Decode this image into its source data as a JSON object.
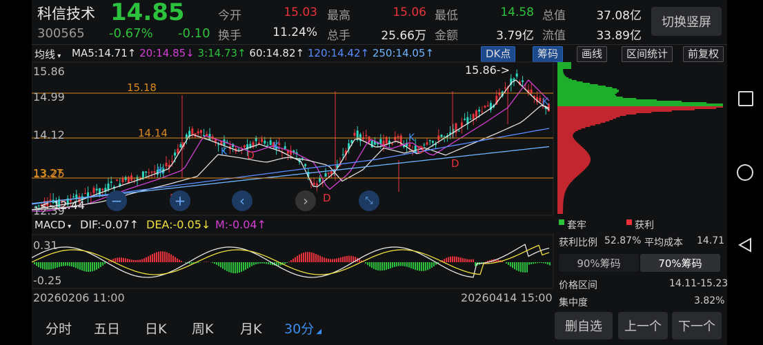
{
  "header": {
    "name": "科信技术",
    "price": "14.85",
    "code": "300565",
    "change_pct": "-0.67%",
    "change": "-0.10",
    "quotes": [
      {
        "label": "今开",
        "value": "15.03",
        "color": "#e8323c"
      },
      {
        "label": "最高",
        "value": "15.06",
        "color": "#e8323c"
      },
      {
        "label": "最低",
        "value": "14.58",
        "color": "#2cc23e"
      },
      {
        "label": "总值",
        "value": "37.08亿",
        "color": "#e8e8e8"
      },
      {
        "label": "换手",
        "value": "11.24%",
        "color": "#e8e8e8"
      },
      {
        "label": "总手",
        "value": "25.66万",
        "color": "#e8e8e8"
      },
      {
        "label": "金额",
        "value": "3.79亿",
        "color": "#e8e8e8"
      },
      {
        "label": "流值",
        "value": "33.89亿",
        "color": "#e8e8e8"
      }
    ],
    "switch_label": "切换竖屏"
  },
  "ma_bar": {
    "selector": "均线",
    "items": [
      {
        "text": "MA5:14.71↑",
        "color": "#e8e8e8"
      },
      {
        "text": "20:14.85↓",
        "color": "#d43fd4"
      },
      {
        "text": "3:14.73↑",
        "color": "#2cc23e"
      },
      {
        "text": "60:14.82↑",
        "color": "#e8e8e8"
      },
      {
        "text": "120:14.42↑",
        "color": "#5b8cff"
      },
      {
        "text": "250:14.05↑",
        "color": "#6fb6ff"
      }
    ],
    "tools": [
      "DK点",
      "筹码",
      "画线",
      "区间统计",
      "前复权"
    ]
  },
  "main_chart": {
    "y_labels": [
      "15.86",
      "14.99",
      "14.12",
      "13.25",
      "12.39"
    ],
    "annotations": {
      "high": "15.86->",
      "low": "<-12.44",
      "level1": "15.18",
      "level2": "14.14",
      "level3": "13.27"
    },
    "marks": [
      "K",
      "K",
      "D",
      "K",
      "D",
      "D",
      "K",
      "D",
      "D",
      "K"
    ]
  },
  "macd": {
    "selector": "MACD",
    "dif": "DIF:-0.07↑",
    "dea": "DEA:-0.05↓",
    "m": "M:-0.04↑",
    "y_top": "0.31",
    "y_bottom": "-0.25"
  },
  "dates": {
    "start": "20260206 11:00",
    "end": "20260414 15:00"
  },
  "chip_panel": {
    "legend_trapped": "套牢",
    "legend_profit": "获利",
    "profit_ratio_label": "获利比例",
    "profit_ratio": "52.87%",
    "avg_cost_label": "平均成本",
    "avg_cost": "14.71",
    "btn_90": "90%筹码",
    "btn_70": "70%筹码",
    "price_range_label": "价格区间",
    "price_range": "14.11-15.23",
    "concentration_label": "集中度",
    "concentration": "3.82%"
  },
  "period_tabs": [
    "分时",
    "五日",
    "日K",
    "周K",
    "月K",
    "30分"
  ],
  "active_tab": "30分",
  "bottom_buttons": [
    "删自选",
    "上一个",
    "下一个"
  ]
}
